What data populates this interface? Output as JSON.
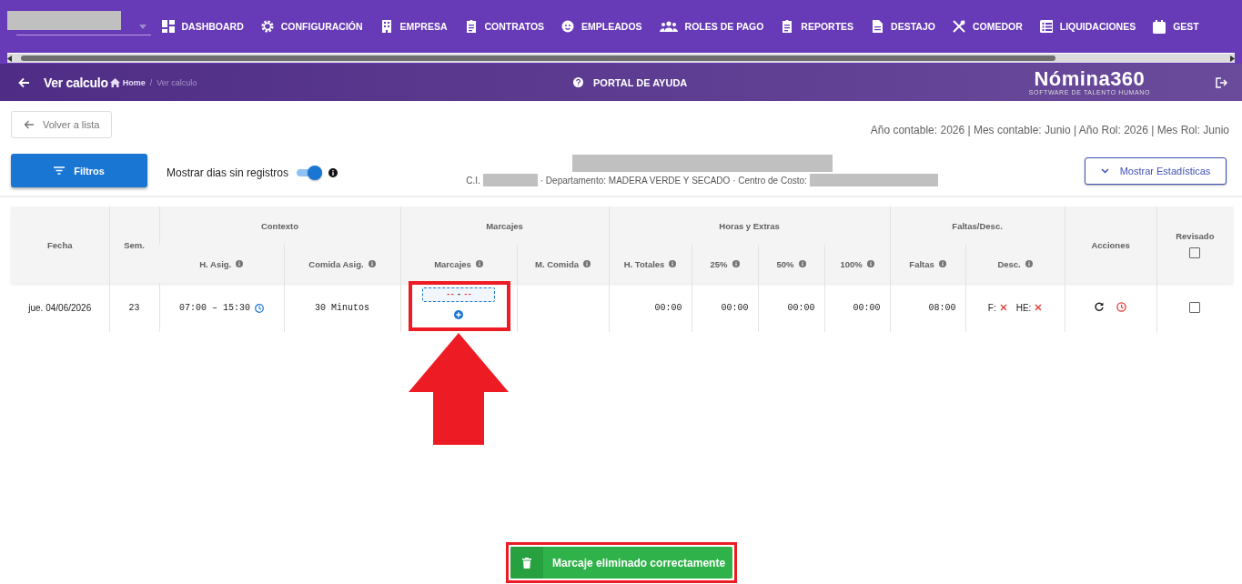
{
  "nav": {
    "items": [
      {
        "label": "DASHBOARD"
      },
      {
        "label": "CONFIGURACIÓN"
      },
      {
        "label": "EMPRESA"
      },
      {
        "label": "CONTRATOS"
      },
      {
        "label": "EMPLEADOS"
      },
      {
        "label": "ROLES DE PAGO"
      },
      {
        "label": "REPORTES"
      },
      {
        "label": "DESTAJO"
      },
      {
        "label": "COMEDOR"
      },
      {
        "label": "LIQUIDACIONES"
      },
      {
        "label": "GEST"
      }
    ]
  },
  "header": {
    "title": "Ver calculo",
    "breadcrumb_separator": "/",
    "breadcrumb": [
      {
        "label": "Home",
        "current": false
      },
      {
        "label": "Ver calculo",
        "current": true
      }
    ],
    "help": "PORTAL DE AYUDA",
    "logo": {
      "name": "Nómina360",
      "tagline": "SOFTWARE DE TALENTO HUMANO"
    }
  },
  "toolbar": {
    "back": "Volver a lista",
    "period": "Año contable: 2026 | Mes contable: Junio | Año Rol: 2026 | Mes Rol: Junio",
    "filters": "Filtros",
    "toggle": {
      "label": "Mostrar dias sin registros",
      "on": true
    },
    "employee": {
      "id_label": "C.I.",
      "details": "· Departamento: MADERA VERDE Y SECADO · Centro de Costo:"
    },
    "stats": "Mostrar Estadísticas"
  },
  "table": {
    "groups": [
      {
        "label": "Contexto"
      },
      {
        "label": "Marcajes"
      },
      {
        "label": "Horas y Extras"
      },
      {
        "label": "Faltas/Desc."
      }
    ],
    "columns": [
      {
        "label": "Fecha",
        "kind": "plain"
      },
      {
        "label": "Sem.",
        "kind": "plain"
      },
      {
        "label": "H. Asig.",
        "kind": "info"
      },
      {
        "label": "Comida Asig.",
        "kind": "info"
      },
      {
        "label": "Marcajes",
        "kind": "info"
      },
      {
        "label": "M. Comida",
        "kind": "info"
      },
      {
        "label": "H. Totales",
        "kind": "info"
      },
      {
        "label": "25%",
        "kind": "info"
      },
      {
        "label": "50%",
        "kind": "info"
      },
      {
        "label": "100%",
        "kind": "info"
      },
      {
        "label": "Faltas",
        "kind": "info"
      },
      {
        "label": "Desc.",
        "kind": "info"
      },
      {
        "label": "Acciones",
        "kind": "plain"
      },
      {
        "label": "Revisado",
        "kind": "checkbox",
        "checked": false
      }
    ],
    "rows": [
      {
        "cells": [
          {
            "kind": "text",
            "value": "jue. 04/06/2026"
          },
          {
            "kind": "mono",
            "value": "23"
          },
          {
            "kind": "schedule",
            "value": "07:00 – 15:30"
          },
          {
            "kind": "mono",
            "value": "30 Minutos"
          },
          {
            "kind": "punches",
            "start": "--",
            "separator": "-",
            "end": "--"
          },
          {
            "kind": "empty"
          },
          {
            "kind": "hours",
            "value": "00:00"
          },
          {
            "kind": "hours",
            "value": "00:00"
          },
          {
            "kind": "hours",
            "value": "00:00"
          },
          {
            "kind": "hours",
            "value": "00:00"
          },
          {
            "kind": "hours",
            "value": "08:00"
          },
          {
            "kind": "flags",
            "items": [
              {
                "label": "F:",
                "ok": false
              },
              {
                "label": "HE:",
                "ok": false
              }
            ]
          },
          {
            "kind": "actions"
          },
          {
            "kind": "checkbox",
            "checked": false
          }
        ]
      }
    ]
  },
  "toast": {
    "message": "Marcaje eliminado correctamente"
  }
}
